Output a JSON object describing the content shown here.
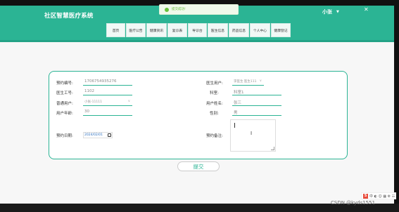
{
  "header": {
    "brand": "社区智慧医疗系统",
    "user": "小张",
    "user_caret": "▼",
    "close": "✕",
    "nav_items": [
      "首页",
      "医疗公告",
      "健康资讯",
      "复诊表",
      "导诊台",
      "医生信息",
      "药品信息",
      "个人中心",
      "健康登记"
    ]
  },
  "toast": {
    "text": "提交成功!"
  },
  "form": {
    "appointment_no_label": "预约编号:",
    "appointment_no_value": "1706754935276",
    "doctor_user_label": "医生用户:",
    "doctor_user_value": "李医生 医生111",
    "doctor_no_label": "医生工号:",
    "doctor_no_value": "1102",
    "department_label": "科室:",
    "department_value": "科室1",
    "normal_user_label": "普通用户:",
    "normal_user_value": "小张-11111",
    "user_name_label": "用户姓名:",
    "user_name_value": "张三",
    "user_age_label": "用户年龄:",
    "user_age_value": "30",
    "gender_label": "性别:",
    "gender_value": "男",
    "date_label": "预约日期:",
    "date_value": "2024/02/01",
    "remark_label": "预约备注:",
    "ibeam": "I",
    "select_arrow": "∨"
  },
  "submit_label": "提交",
  "tray": {
    "icons": "中 ◐ ☺ ▦ ⚙ ☷",
    "s_badge": "S"
  },
  "watermark": "CSDN @kyds1551"
}
